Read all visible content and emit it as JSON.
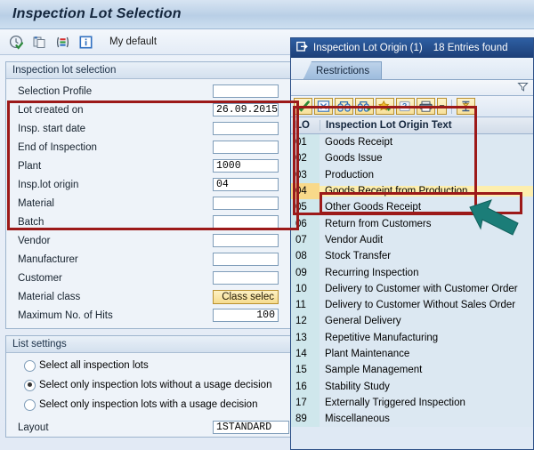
{
  "window": {
    "title": "Inspection Lot Selection",
    "toolbar": {
      "execute_icon": "execute-clock-icon",
      "copy_icon": "copy-icon",
      "variant_icon": "variants-icon",
      "info_icon": "info-icon",
      "my_default_label": "My default"
    }
  },
  "selection_section": {
    "header": "Inspection lot selection",
    "fields": [
      {
        "label": "Selection Profile",
        "value": "",
        "type": "text"
      },
      {
        "label": "Lot created on",
        "value": "26.09.2015",
        "type": "text"
      },
      {
        "label": "Insp. start date",
        "value": "",
        "type": "text"
      },
      {
        "label": "End of Inspection",
        "value": "",
        "type": "text"
      },
      {
        "label": "Plant",
        "value": "1000",
        "type": "text"
      },
      {
        "label": "Insp.lot origin",
        "value": "04",
        "type": "text"
      },
      {
        "label": "Material",
        "value": "",
        "type": "text"
      },
      {
        "label": "Batch",
        "value": "",
        "type": "text"
      },
      {
        "label": "Vendor",
        "value": "",
        "type": "text"
      },
      {
        "label": "Manufacturer",
        "value": "",
        "type": "text"
      },
      {
        "label": "Customer",
        "value": "",
        "type": "text"
      },
      {
        "label": "Material class",
        "value": "Class selec",
        "type": "button"
      },
      {
        "label": "Maximum No. of Hits",
        "value": "100",
        "type": "number"
      }
    ]
  },
  "list_settings": {
    "header": "List settings",
    "options": [
      {
        "label": "Select all inspection lots",
        "selected": false
      },
      {
        "label": "Select only inspection lots without a usage decision",
        "selected": true
      },
      {
        "label": "Select only inspection lots with a usage decision",
        "selected": false
      }
    ],
    "layout_label": "Layout",
    "layout_value": "1STANDARD"
  },
  "dialog": {
    "window_icon": "dialog-window-icon",
    "title": "Inspection Lot Origin (1)",
    "entries_found": "18 Entries found",
    "tab_label": "Restrictions",
    "filter_icon": "filter-dropdown-icon",
    "toolbar_icons": [
      "check-green-icon",
      "cancel-x-icon",
      "find-binoculars-icon",
      "find-next-binoculars-icon",
      "add-favorite-star-icon",
      "help-hand-icon",
      "print-icon",
      "print-dropdown-icon",
      "personal-value-list-icon"
    ],
    "columns": [
      "LO",
      "Inspection Lot Origin Text"
    ],
    "rows": [
      {
        "key": "01",
        "text": "Goods Receipt",
        "selected": false
      },
      {
        "key": "02",
        "text": "Goods Issue",
        "selected": false
      },
      {
        "key": "03",
        "text": "Production",
        "selected": false
      },
      {
        "key": "04",
        "text": "Goods Receipt from Production",
        "selected": true
      },
      {
        "key": "05",
        "text": "Other Goods Receipt",
        "selected": false
      },
      {
        "key": "06",
        "text": "Return from Customers",
        "selected": false
      },
      {
        "key": "07",
        "text": "Vendor Audit",
        "selected": false
      },
      {
        "key": "08",
        "text": "Stock Transfer",
        "selected": false
      },
      {
        "key": "09",
        "text": "Recurring Inspection",
        "selected": false
      },
      {
        "key": "10",
        "text": "Delivery to Customer with Customer Order",
        "selected": false
      },
      {
        "key": "11",
        "text": "Delivery to Customer Without Sales Order",
        "selected": false
      },
      {
        "key": "12",
        "text": "General Delivery",
        "selected": false
      },
      {
        "key": "13",
        "text": "Repetitive Manufacturing",
        "selected": false
      },
      {
        "key": "14",
        "text": "Plant Maintenance",
        "selected": false
      },
      {
        "key": "15",
        "text": "Sample Management",
        "selected": false
      },
      {
        "key": "16",
        "text": "Stability Study",
        "selected": false
      },
      {
        "key": "17",
        "text": "Externally Triggered Inspection",
        "selected": false
      },
      {
        "key": "89",
        "text": "Miscellaneous",
        "selected": false
      }
    ]
  },
  "annotations": {
    "highlight_color": "#9c1919",
    "arrow_color": "#1b7d78"
  }
}
